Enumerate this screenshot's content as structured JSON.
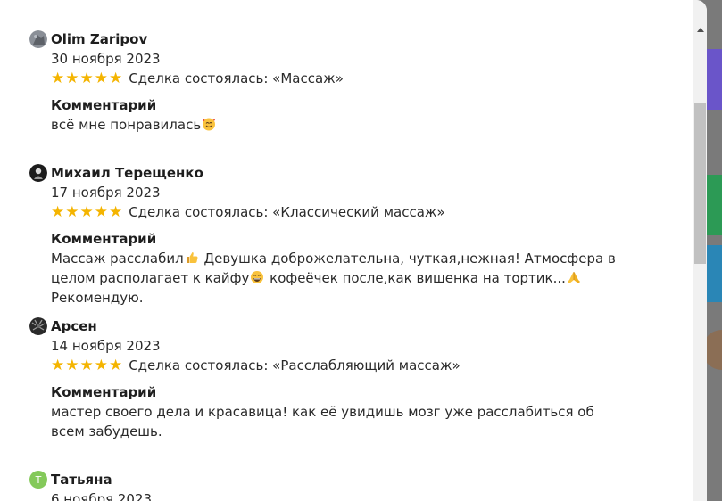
{
  "reviews": [
    {
      "name": "Olim Zaripov",
      "date": "30 ноября 2023",
      "stars": "★★★★★",
      "deal": "Сделка состоялась: «Массаж»",
      "comment_label": "Комментарий",
      "comment_parts": [
        "всё мне понравилась"
      ]
    },
    {
      "name": "Михаил Терещенко",
      "date": "17 ноября 2023",
      "stars": "★★★★★",
      "deal": "Сделка состоялась: «Классический массаж»",
      "comment_label": "Комментарий",
      "comment_parts": [
        "Массаж расслабил",
        " Девушка доброжелательна, чуткая,нежная! Атмосфера в целом располагает к кайфу",
        " кофеёчек после,как вишенка на тортик...",
        " Рекомендую."
      ]
    },
    {
      "name": "Арсен",
      "date": "14 ноября 2023",
      "stars": "★★★★★",
      "deal": "Сделка состоялась: «Расслабляющий массаж»",
      "comment_label": "Комментарий",
      "comment_parts": [
        "мастер своего дела и красавица! как её увидишь мозг уже расслабиться об всем забудешь."
      ]
    },
    {
      "name": "Татьяна",
      "avatar_letter": "Т",
      "date": "6 ноября 2023"
    }
  ],
  "colors": {
    "star": "#f4b400",
    "avatar_tatiana": "#84c95a",
    "scrollbar_thumb": "#c1c1c1"
  },
  "icons": {
    "emoji_1": "smiling-face-with-hearts",
    "emoji_2": "thumbs-up",
    "emoji_3": "grinning-face",
    "emoji_4": "folded-hands"
  }
}
